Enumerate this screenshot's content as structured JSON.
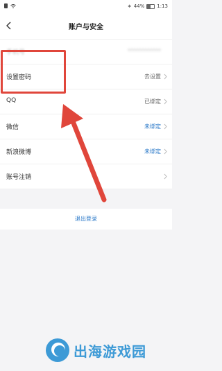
{
  "status_bar": {
    "battery": "44%",
    "time": "1:13"
  },
  "header": {
    "title": "账户与安全"
  },
  "rows": [
    {
      "label": "手机号",
      "value": "************"
    },
    {
      "label": "设置密码",
      "value": "去设置"
    },
    {
      "label": "QQ",
      "value": "已绑定"
    },
    {
      "label": "微信",
      "value": "未绑定"
    },
    {
      "label": "新浪微博",
      "value": "未绑定"
    },
    {
      "label": "账号注销",
      "value": ""
    }
  ],
  "logout_label": "退出登录",
  "watermark": "出海游戏园",
  "colors": {
    "accent_blue": "#2a78c8",
    "annotation_red": "#e0463b"
  }
}
